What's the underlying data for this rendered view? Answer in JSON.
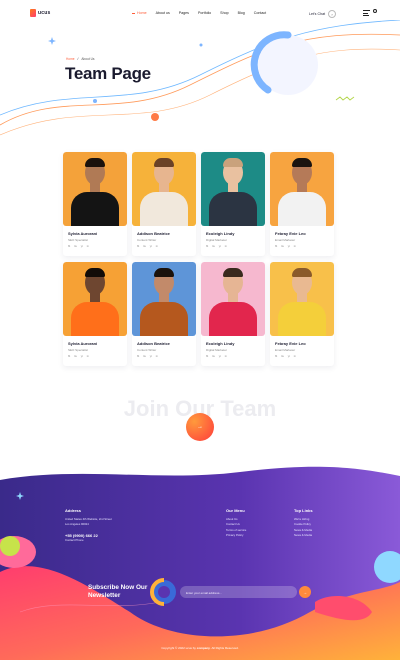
{
  "header": {
    "logo_text": "ucus",
    "nav": [
      "Home",
      "About us",
      "Pages",
      "Portfolio",
      "Shop",
      "Blog",
      "Contact"
    ],
    "active_nav": "Home",
    "chat_label": "Let's Chat"
  },
  "hero": {
    "breadcrumb_home": "Home",
    "breadcrumb_current": "About Us",
    "title": "Team Page"
  },
  "team": [
    {
      "name": "Sylvia Aurorani",
      "role": "SEO Specialist",
      "socials": [
        "fb",
        "tw",
        "yt",
        "in"
      ],
      "bg": "#f4a23a",
      "skin": "#b07a55",
      "hair": "#1b120c",
      "shirt": "#141414"
    },
    {
      "name": "Addison Beatrice",
      "role": "Content Writer",
      "socials": [
        "fb",
        "tw",
        "yt",
        "in"
      ],
      "bg": "#f6b23a",
      "skin": "#e7b58f",
      "hair": "#6b4226",
      "shirt": "#f1e8dc"
    },
    {
      "name": "Ecoleigh Lindy",
      "role": "Digital Marketer",
      "socials": [
        "fb",
        "tw",
        "yt",
        "in"
      ],
      "bg": "#1d8b86",
      "skin": "#e9c1a0",
      "hair": "#c9a27c",
      "shirt": "#2b3442"
    },
    {
      "name": "Febray Evie Leo",
      "role": "Email Marketer",
      "socials": [
        "fb",
        "tw",
        "yt",
        "in"
      ],
      "bg": "#f7a440",
      "skin": "#b57a58",
      "hair": "#1a1410",
      "shirt": "#f2f2f2"
    },
    {
      "name": "Sylvia Aurorani",
      "role": "SEO Specialist",
      "socials": [
        "fb",
        "tw",
        "yt",
        "in"
      ],
      "bg": "#f6a135",
      "skin": "#6e4630",
      "hair": "#120c08",
      "shirt": "#ff6f1a"
    },
    {
      "name": "Addison Beatrice",
      "role": "Content Writer",
      "socials": [
        "fb",
        "tw",
        "yt",
        "in"
      ],
      "bg": "#5e95d8",
      "skin": "#c28a6a",
      "hair": "#1b120c",
      "shirt": "#b5581e"
    },
    {
      "name": "Ecoleigh Lindy",
      "role": "Digital Marketer",
      "socials": [
        "fb",
        "tw",
        "yt",
        "in"
      ],
      "bg": "#f6b8cf",
      "skin": "#e6b594",
      "hair": "#3a2a1e",
      "shirt": "#e2264d"
    },
    {
      "name": "Febray Evie Leo",
      "role": "Email Marketer",
      "socials": [
        "fb",
        "tw",
        "yt",
        "in"
      ],
      "bg": "#f8c04a",
      "skin": "#e9b991",
      "hair": "#8a5a2a",
      "shirt": "#f4cf3a"
    }
  ],
  "join": {
    "title": "Join Our Team",
    "button_icon": "arrow-right-icon"
  },
  "footer": {
    "address_title": "Address",
    "address_lines": [
      "United States 4th Website, 2nd Street",
      "Los Angeles 90024"
    ],
    "phone": "+55 (9900) 666 22",
    "contact_label": "Contact Phone",
    "menu_title": "Our Menu",
    "menu_items": [
      "About Us",
      "Contact Us",
      "Terms of service",
      "Privacy Policy"
    ],
    "links_title": "Top Links",
    "links_items": [
      "We're Hiring",
      "Cookie Policy",
      "News & Media",
      "News & Media"
    ],
    "subscribe_title": "Subscribe Now Our Newsletter",
    "subscribe_placeholder": "Enter your email address...",
    "copyright_prefix": "Copyright © 2022 ucus by",
    "copyright_brand": "company",
    "copyright_suffix": ". All Rights Reserved."
  },
  "colors": {
    "accent": "#ff5e3a",
    "footer_purple": "#4a2a9a",
    "footer_pink": "#ff4d7a",
    "footer_orange": "#ffb23a"
  }
}
